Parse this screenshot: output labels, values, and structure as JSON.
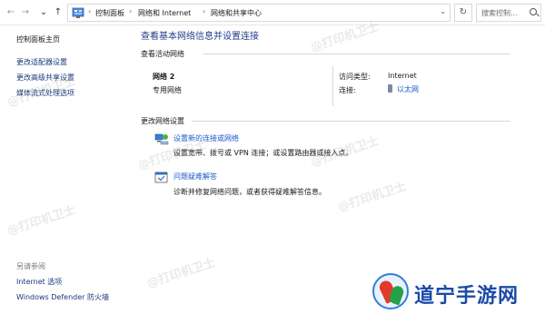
{
  "address_bar": {
    "back_glyph": "←",
    "forward_glyph": "→",
    "history_glyph": "⌄",
    "up_glyph": "↑",
    "breadcrumbs": [
      "控制面板",
      "网络和 Internet",
      "网络和共享中心"
    ],
    "separator": "›",
    "dropdown_glyph": "⌄",
    "refresh_glyph": "↻",
    "search_placeholder": "搜索控制..."
  },
  "sidebar": {
    "home": "控制面板主页",
    "links": [
      "更改适配器设置",
      "更改高级共享设置",
      "媒体流式处理选项"
    ],
    "see_also_heading": "另请参阅",
    "see_also": [
      "Internet 选项",
      "Windows Defender 防火墙"
    ]
  },
  "main": {
    "title": "查看基本网络信息并设置连接",
    "active_networks_heading": "查看活动网络",
    "network": {
      "name": "网络 2",
      "category": "专用网络",
      "access_type_label": "访问类型:",
      "access_type_value": "Internet",
      "connections_label": "连接:",
      "connections_value": "以太网"
    },
    "change_settings_heading": "更改网络设置",
    "tasks": [
      {
        "icon": "network-setup-icon",
        "title": "设置新的连接或网络",
        "desc": "设置宽带、拨号或 VPN 连接；或设置路由器或接入点。"
      },
      {
        "icon": "troubleshoot-icon",
        "title": "问题疑难解答",
        "desc": "诊断并修复网络问题，或者获得疑难解答信息。"
      }
    ]
  },
  "watermark_text": "@打印机卫士",
  "logo_text": "道宁手游网",
  "colors": {
    "link": "#1e5ac8",
    "title": "#1e3f8a",
    "logo_blue": "#1b4aa8"
  }
}
